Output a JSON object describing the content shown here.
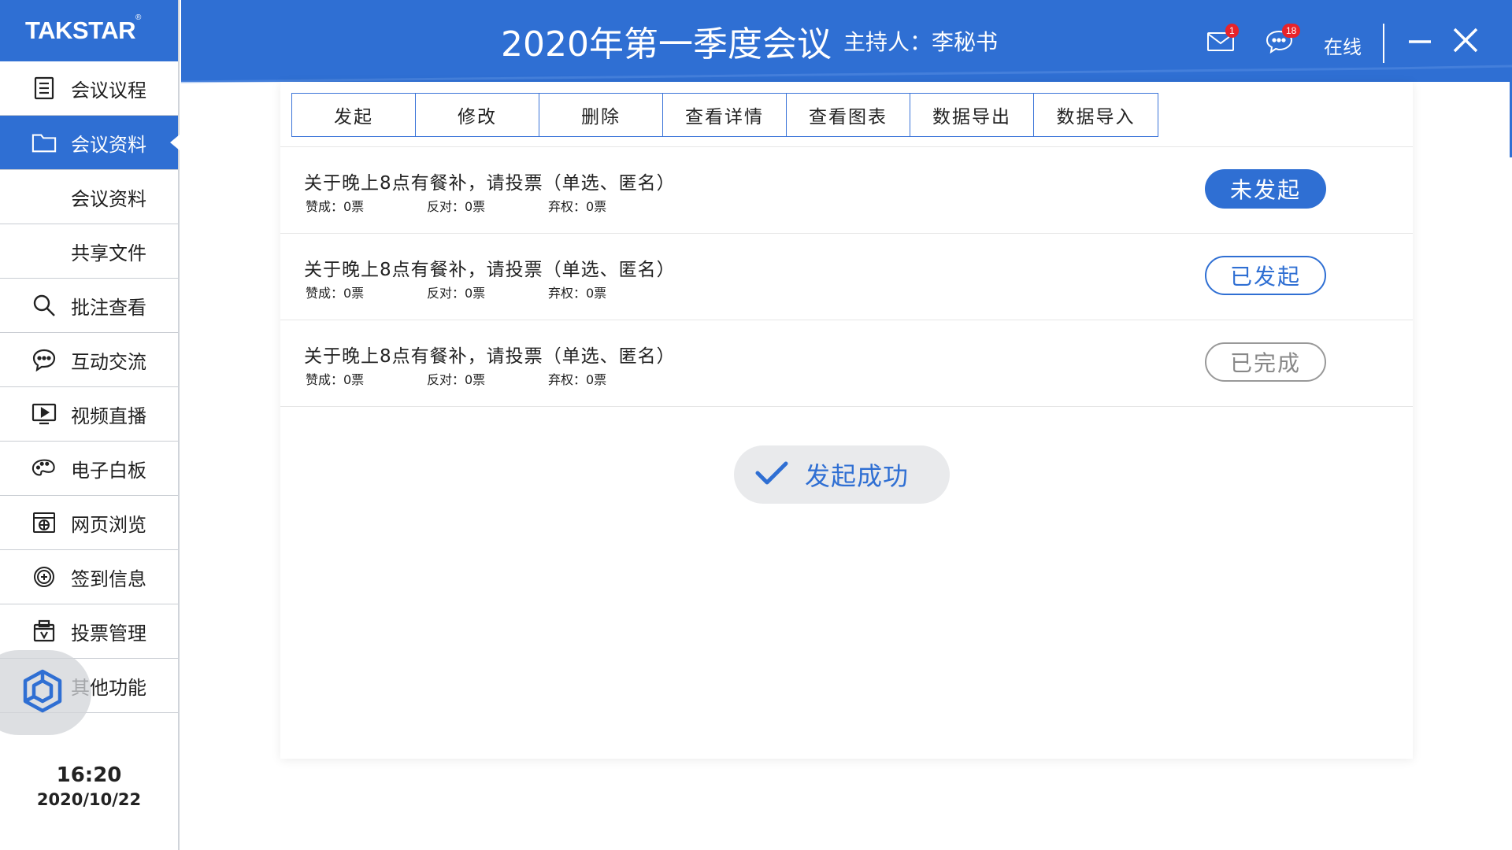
{
  "app": {
    "logo": "TAKSTAR",
    "logo_mark": "®"
  },
  "header": {
    "title": "2020年第一季度会议",
    "host": "主持人：李秘书",
    "mail_count": "1",
    "chat_count": "18",
    "status": "在线"
  },
  "sidebar": {
    "items": [
      {
        "label": "会议议程",
        "icon": "agenda-icon"
      },
      {
        "label": "会议资料",
        "icon": "folder-icon"
      },
      {
        "label": "会议资料",
        "icon": ""
      },
      {
        "label": "共享文件",
        "icon": ""
      },
      {
        "label": "批注查看",
        "icon": "search-icon"
      },
      {
        "label": "互动交流",
        "icon": "chat-icon"
      },
      {
        "label": "视频直播",
        "icon": "video-icon"
      },
      {
        "label": "电子白板",
        "icon": "palette-icon"
      },
      {
        "label": "网页浏览",
        "icon": "browser-icon"
      },
      {
        "label": "签到信息",
        "icon": "signin-icon"
      },
      {
        "label": "投票管理",
        "icon": "vote-icon"
      },
      {
        "label": "其他功能",
        "icon": "app-logo-icon"
      }
    ],
    "time": "16:20",
    "date": "2020/10/22"
  },
  "toolbar": {
    "buttons": [
      "发起",
      "修改",
      "删除",
      "查看详情",
      "查看图表",
      "数据导出",
      "数据导入"
    ]
  },
  "votes": [
    {
      "title": "关于晚上8点有餐补，请投票（单选、匿名）",
      "yes": "赞成：0票",
      "no": "反对：0票",
      "abstain": "弃权：0票",
      "status": "未发起"
    },
    {
      "title": "关于晚上8点有餐补，请投票（单选、匿名）",
      "yes": "赞成：0票",
      "no": "反对：0票",
      "abstain": "弃权：0票",
      "status": "已发起"
    },
    {
      "title": "关于晚上8点有餐补，请投票（单选、匿名）",
      "yes": "赞成：0票",
      "no": "反对：0票",
      "abstain": "弃权：0票",
      "status": "已完成"
    }
  ],
  "toast": {
    "text": "发起成功"
  },
  "colors": {
    "primary": "#2f6fd3",
    "badge": "#e8232a",
    "done_gray": "#999999"
  }
}
